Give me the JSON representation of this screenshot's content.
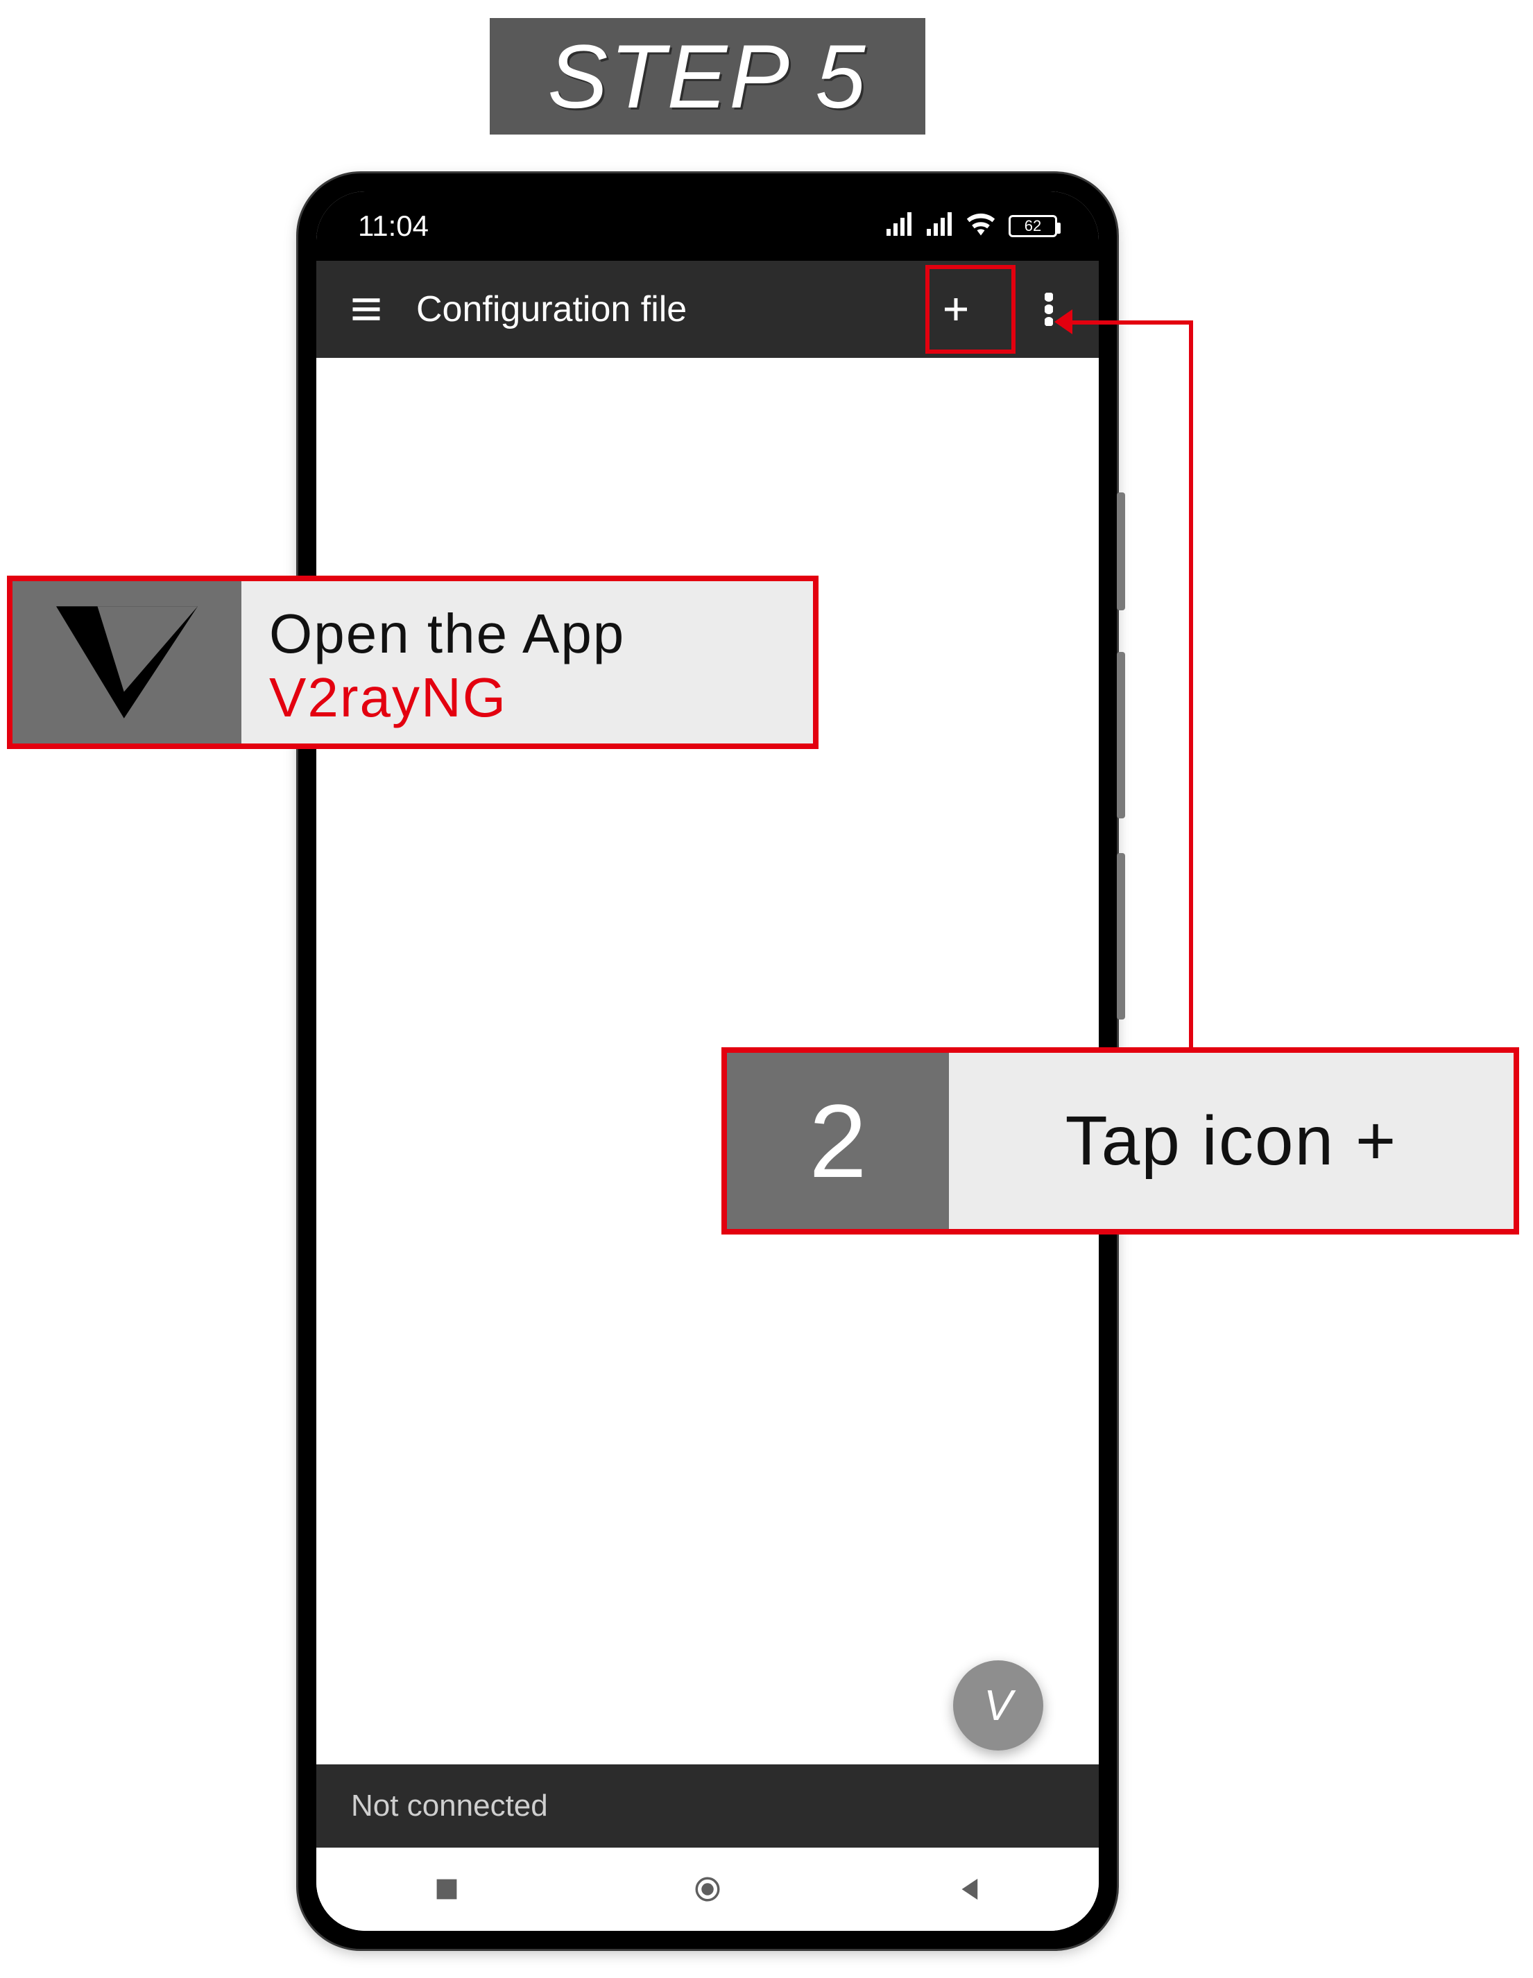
{
  "step_label": "STEP 5",
  "statusbar": {
    "time": "11:04",
    "battery": "62"
  },
  "appbar": {
    "title": "Configuration file"
  },
  "fab_glyph": "V",
  "bottom": {
    "status": "Not connected"
  },
  "callout1": {
    "line1": "Open the App",
    "line2": "V2rayNG",
    "icon_glyph": "V"
  },
  "callout2": {
    "number": "2",
    "text": "Tap icon +"
  }
}
